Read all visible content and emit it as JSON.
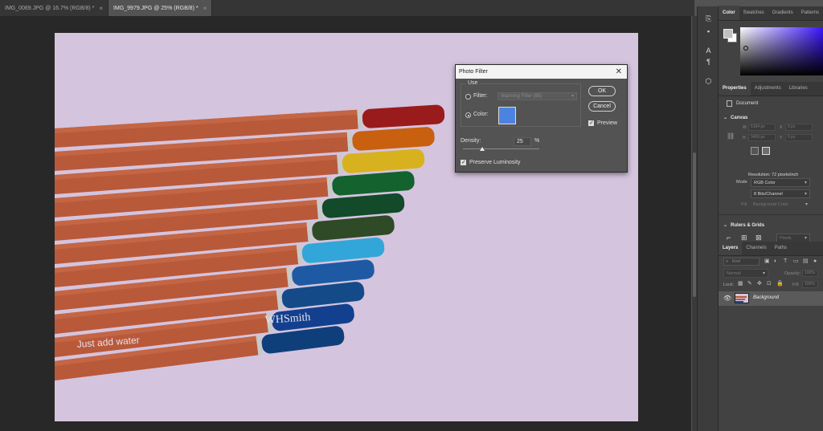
{
  "tabs": [
    {
      "label": "IMG_0069.JPG @ 16.7% (RGB/8) *",
      "active": false
    },
    {
      "label": "IMG_9979.JPG @ 25% (RGB/8) *",
      "active": true
    }
  ],
  "tab_close_glyph": "×",
  "tool_icons": [
    "history-icon",
    "comment-icon",
    "character-icon",
    "paragraph-icon",
    "3d-cube-icon"
  ],
  "color_panel": {
    "tabs": [
      "Color",
      "Swatches",
      "Gradients",
      "Patterns"
    ],
    "foreground": "#c0c0c0",
    "background": "#ffffff",
    "hue": "#3a12ff"
  },
  "properties_panel": {
    "tabs": [
      "Properties",
      "Adjustments",
      "Libraries"
    ],
    "document_label": "Document",
    "canvas_title": "Canvas",
    "fields": {
      "w_label": "W",
      "w_value": "5184 px",
      "h_label": "H",
      "h_value": "3456 px",
      "x_label": "X",
      "x_value": "0 px",
      "y_label": "Y",
      "y_value": "0 px"
    },
    "resolution": "Resolution: 72 pixels/inch",
    "mode_label": "Mode",
    "mode_value": "RGB Color",
    "depth_value": "8 Bits/Channel",
    "fill_label": "Fill",
    "fill_value": "Background Color",
    "rulers_title": "Rulers & Grids",
    "units_value": "Pixels"
  },
  "layers_panel": {
    "tabs": [
      "Layers",
      "Channels",
      "Paths"
    ],
    "kind_placeholder": "Kind",
    "blend_mode": "Normal",
    "opacity_label": "Opacity:",
    "opacity_value": "100%",
    "lock_label": "Lock:",
    "fill_label": "Fill:",
    "fill_value": "100%",
    "layers": [
      {
        "name": "Background",
        "visible": true
      }
    ]
  },
  "dialog": {
    "title": "Photo Filter",
    "use_label": "Use",
    "filter_label": "Filter:",
    "filter_value": "Warming Filter (85)",
    "color_label": "Color:",
    "selected_option": "color",
    "filter_color": "#4c83e0",
    "ok_label": "OK",
    "cancel_label": "Cancel",
    "preview_label": "Preview",
    "preview_checked": true,
    "density_label": "Density:",
    "density_value": "25",
    "density_unit": "%",
    "density_fraction": 0.25,
    "preserve_label": "Preserve Luminosity",
    "preserve_checked": true
  },
  "photo_text": {
    "brand": "WHSmith",
    "tagline": "Just add water"
  },
  "pencils": [
    {
      "tip": "#9a1b1b"
    },
    {
      "tip": "#c8600f"
    },
    {
      "tip": "#d8b21e"
    },
    {
      "tip": "#14622e"
    },
    {
      "tip": "#134a2a"
    },
    {
      "tip": "#2e4a26"
    },
    {
      "tip": "#32a6d8"
    },
    {
      "tip": "#1e5aa4"
    },
    {
      "tip": "#154a88"
    },
    {
      "tip": "#12408e"
    },
    {
      "tip": "#0f3f7a"
    }
  ]
}
